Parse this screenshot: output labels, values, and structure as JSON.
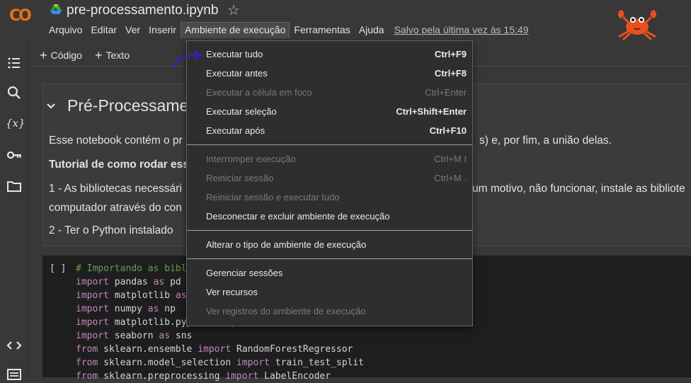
{
  "header": {
    "logo": "CO",
    "notebook_title": "pre-processamento.ipynb",
    "saved_status": "Salvo pela última vez às 15:49"
  },
  "menubar": {
    "items": [
      "Arquivo",
      "Editar",
      "Ver",
      "Inserir",
      "Ambiente de execução",
      "Ferramentas",
      "Ajuda"
    ]
  },
  "toolbar": {
    "code_label": "Código",
    "text_label": "Texto"
  },
  "sidebar": {
    "icons": [
      "table-of-contents-icon",
      "search-icon",
      "variables-icon",
      "key-icon",
      "folder-icon",
      "code-snippets-icon",
      "terminal-icon"
    ],
    "variables_glyph": "{x}"
  },
  "notebook": {
    "heading": "Pré-Processame",
    "paragraphs": [
      {
        "left": "Esse notebook contém o pr",
        "right": "s) e, por fim, a união delas."
      },
      {
        "left": "Tutorial de como rodar ess",
        "right": ""
      },
      {
        "left": "1 - As bibliotecas necessári",
        "right": "um motivo, não funcionar, instale as bibliote"
      },
      {
        "left": "computador através do con",
        "right": ""
      },
      {
        "left": "2 - Ter o Python instalado",
        "right": ""
      }
    ],
    "code_brackets": "[ ]",
    "code_lines": [
      "# Importando as bibl",
      "import pandas as pd",
      "import matplotlib as",
      "import numpy as np",
      "import matplotlib.pyplot as plt",
      "import seaborn as sns",
      "from sklearn.ensemble import RandomForestRegressor",
      "from sklearn.model_selection import train_test_split",
      "from sklearn.preprocessing import LabelEncoder"
    ]
  },
  "runtime_menu": {
    "groups": [
      [
        {
          "label": "Executar tudo",
          "shortcut": "Ctrl+F9",
          "enabled": true
        },
        {
          "label": "Executar antes",
          "shortcut": "Ctrl+F8",
          "enabled": true
        },
        {
          "label": "Executar a célula em foco",
          "shortcut": "Ctrl+Enter",
          "enabled": false
        },
        {
          "label": "Executar seleção",
          "shortcut": "Ctrl+Shift+Enter",
          "enabled": true
        },
        {
          "label": "Executar após",
          "shortcut": "Ctrl+F10",
          "enabled": true
        }
      ],
      [
        {
          "label": "Interromper execução",
          "shortcut": "Ctrl+M I",
          "enabled": false
        },
        {
          "label": "Reiniciar sessão",
          "shortcut": "Ctrl+M .",
          "enabled": false
        },
        {
          "label": "Reiniciar sessão e executar tudo",
          "shortcut": "",
          "enabled": false
        },
        {
          "label": "Desconectar e excluir ambiente de execução",
          "shortcut": "",
          "enabled": true
        }
      ],
      [
        {
          "label": "Alterar o tipo de ambiente de execução",
          "shortcut": "",
          "enabled": true
        }
      ],
      [
        {
          "label": "Gerenciar sessões",
          "shortcut": "",
          "enabled": true
        },
        {
          "label": "Ver recursos",
          "shortcut": "",
          "enabled": true
        },
        {
          "label": "Ver registros do ambiente de execução",
          "shortcut": "",
          "enabled": false
        }
      ]
    ]
  },
  "colors": {
    "background": "#383838",
    "menu_bg": "#2e2e2e",
    "logo_yellow": "#f9ab00",
    "logo_orange": "#e8710a",
    "annotation_arrow": "#3a1fb0",
    "code_comment": "#6a9955",
    "code_keyword": "#c586c0"
  }
}
